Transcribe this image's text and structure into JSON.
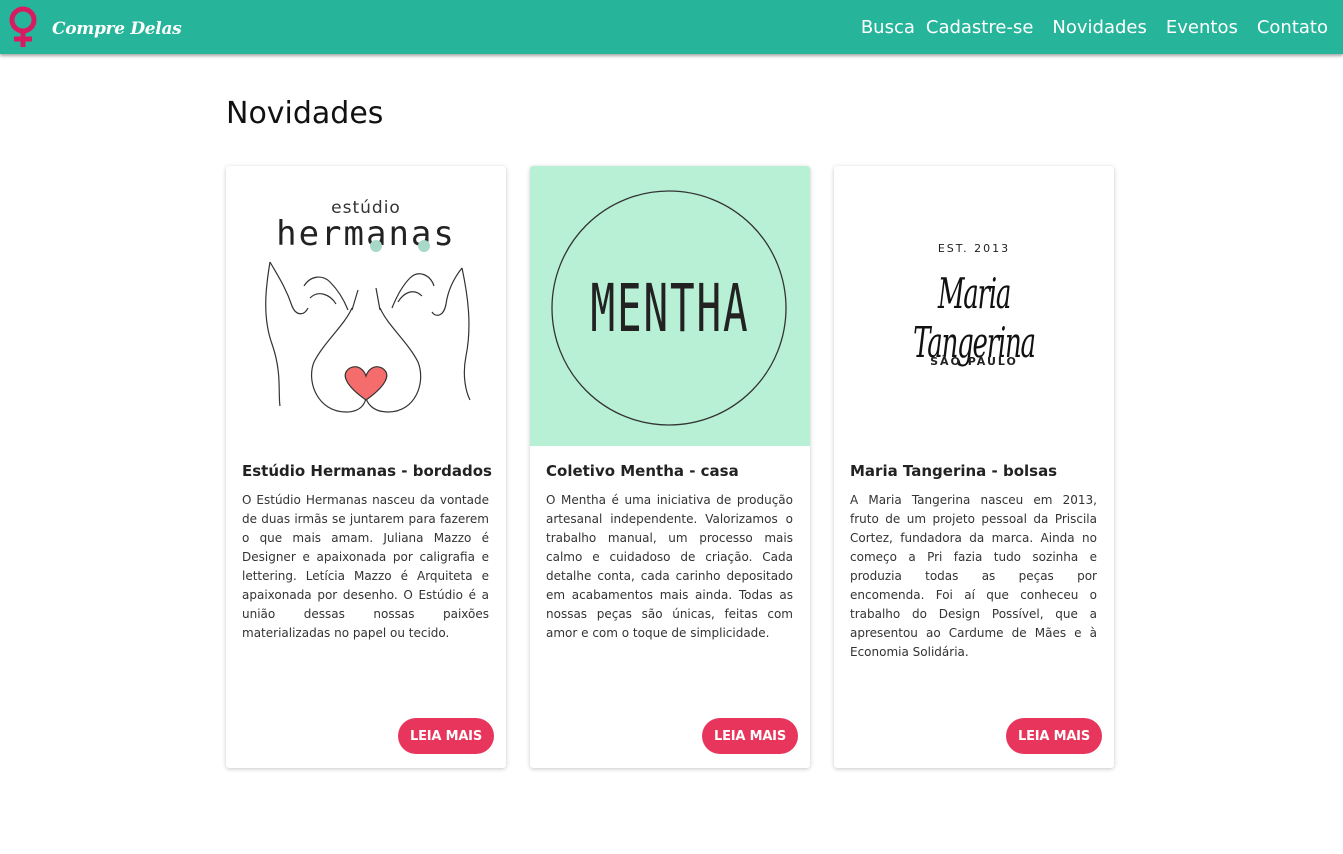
{
  "brand": {
    "name": "Compre Delas",
    "logo_icon": "female-symbol-icon",
    "color": "#d81b60"
  },
  "nav": {
    "items": [
      "Busca",
      "Cadastre-se",
      "Novidades",
      "Eventos",
      "Contato"
    ]
  },
  "page": {
    "title": "Novidades"
  },
  "colors": {
    "header": "#26b59b",
    "button": "#e8355b",
    "mentha_bg": "#b8f0d6"
  },
  "cards": [
    {
      "logo": {
        "top": "estúdio",
        "main": "hermanas"
      },
      "title": "Estúdio Hermanas - bordados",
      "text": "O Estúdio Hermanas nasceu da vontade de duas irmãs se juntarem para fazerem o que mais amam. Juliana Mazzo é Designer e apaixonada por caligrafia e lettering. Letícia Mazzo é Arquiteta e apaixonada por desenho. O Estúdio é a união dessas nossas paixões materializadas no papel ou tecido.",
      "button": "LEIA MAIS"
    },
    {
      "logo": {
        "main": "MENTHA"
      },
      "title": "Coletivo Mentha - casa",
      "text": "O Mentha é uma iniciativa de produção artesanal independente. Valorizamos o trabalho manual, um processo mais calmo e cuidadoso de criação. Cada detalhe conta, cada carinho depositado em acabamentos mais ainda. Todas as nossas peças são únicas, feitas com amor e com o toque de simplicidade.",
      "button": "LEIA MAIS"
    },
    {
      "logo": {
        "top": "EST. 2013",
        "main": "Maria Tangerina",
        "bottom": "SÃO PAULO"
      },
      "title": "Maria Tangerina - bolsas",
      "text": "A Maria Tangerina nasceu em 2013, fruto de um projeto pessoal da Priscila Cortez, fundadora da marca. Ainda no começo a Pri fazia tudo sozinha e produzia todas as peças por encomenda. Foi aí que conheceu o trabalho do Design Possível, que a apresentou ao Cardume de Mães e à Economia Solidária.",
      "button": "LEIA MAIS"
    }
  ]
}
